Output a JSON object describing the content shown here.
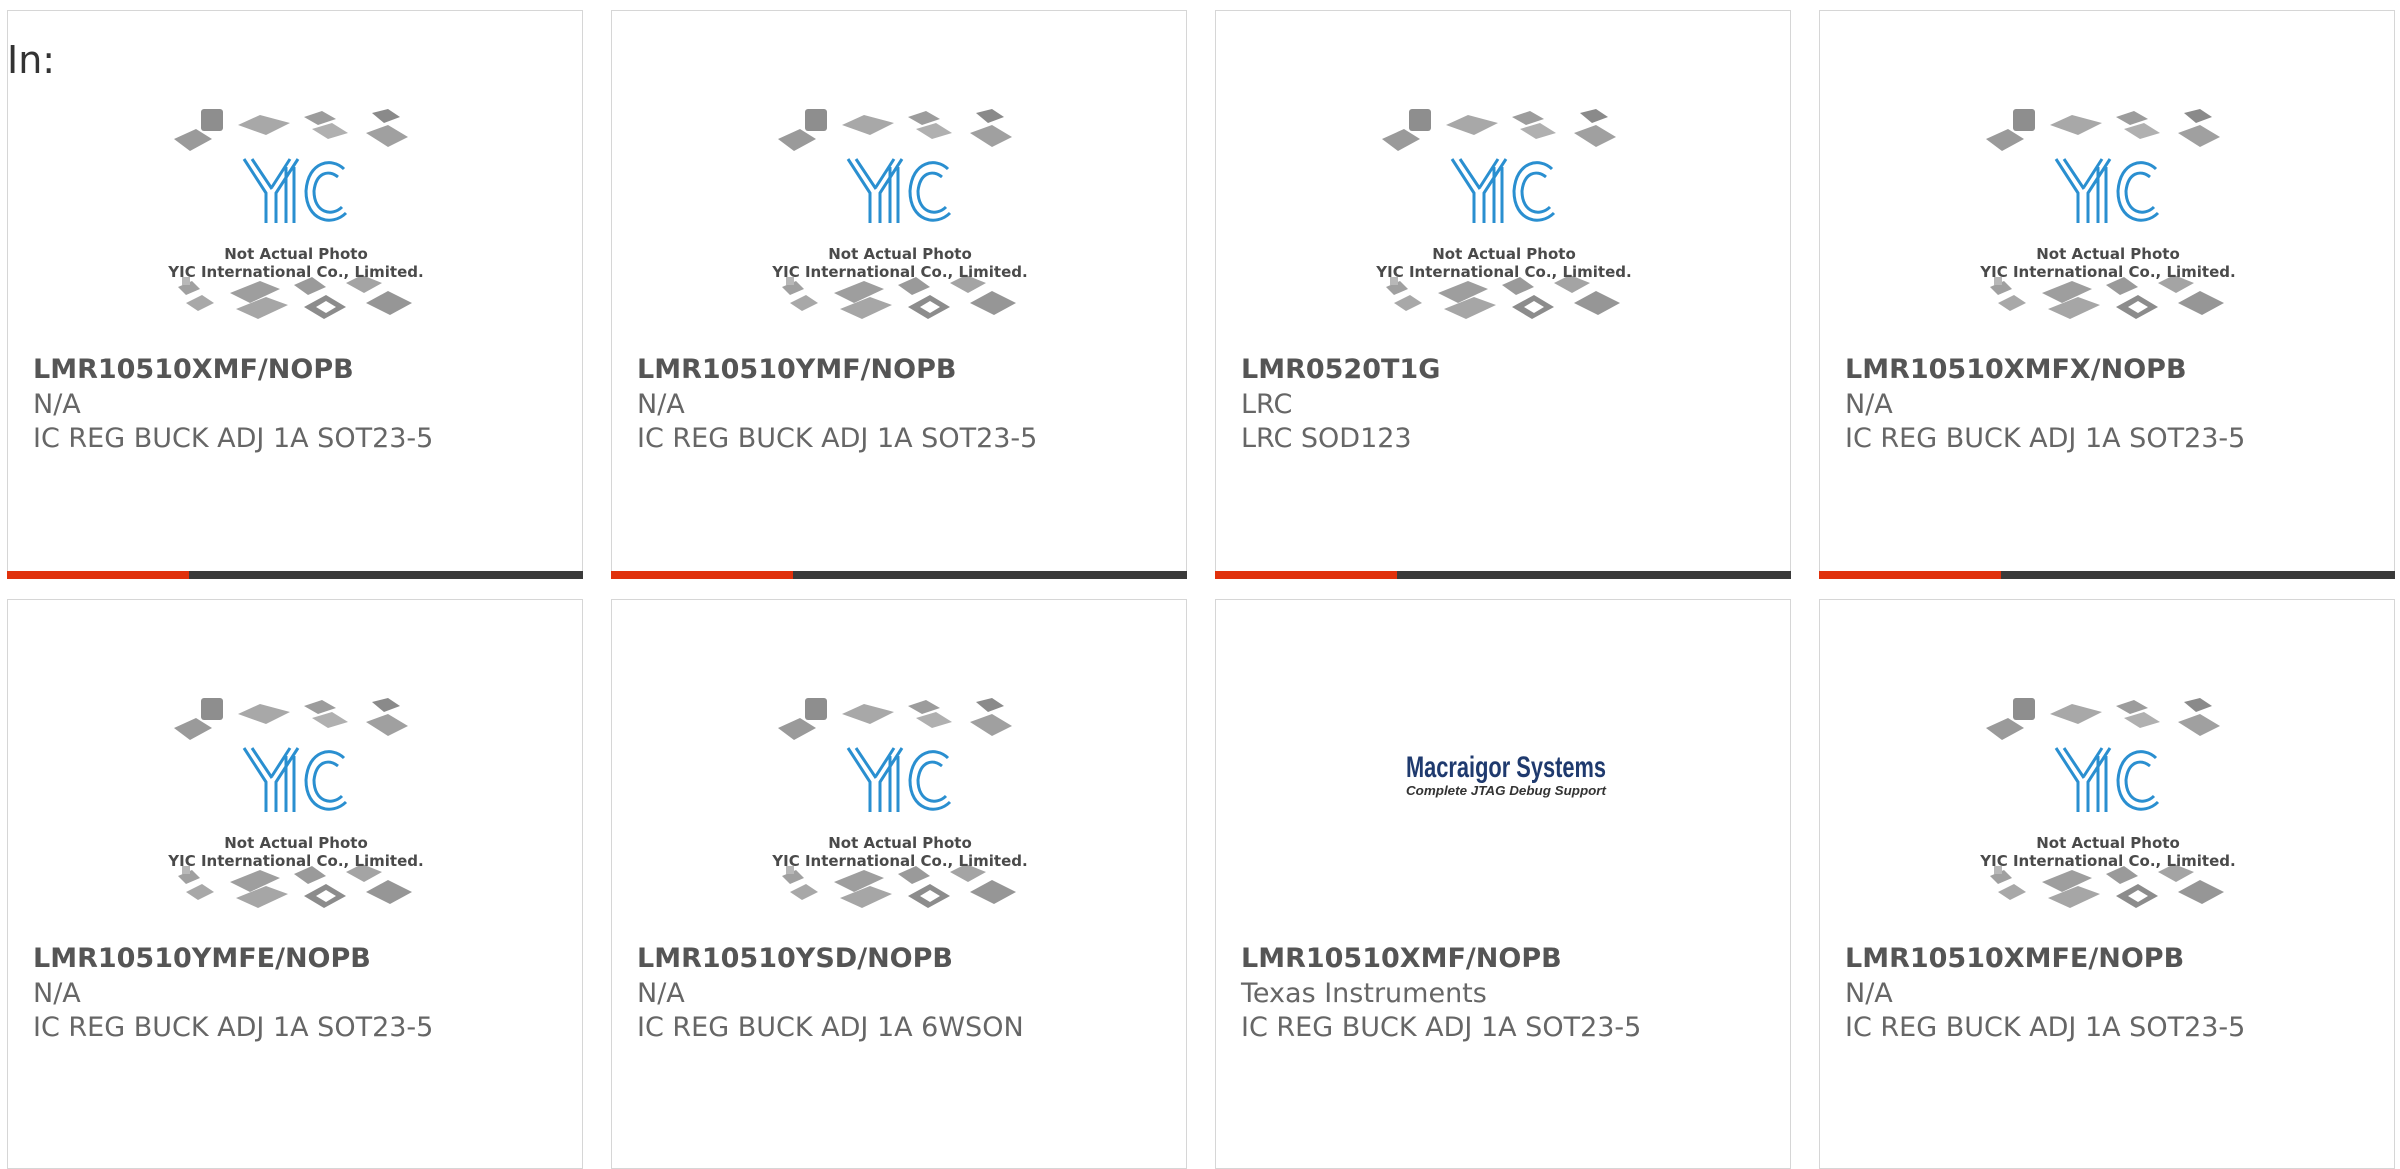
{
  "page": {
    "in_label": "In:"
  },
  "placeholder": {
    "caption_line1": "Not Actual Photo",
    "caption_line2": "YIC International Co., Limited.",
    "logo_text": "YIC"
  },
  "macraigor": {
    "logo_line1": "Macraigor Systems",
    "logo_line2": "Complete JTAG Debug Support"
  },
  "colors": {
    "accent": "#e0310c",
    "bar": "#3a3a3a",
    "yic_blue": "#2a8fd0"
  },
  "cards": [
    {
      "part": "LMR10510XMF/NOPB",
      "manufacturer": "N/A",
      "description": "IC REG BUCK ADJ 1A SOT23-5",
      "image": "yic-placeholder"
    },
    {
      "part": "LMR10510YMF/NOPB",
      "manufacturer": "N/A",
      "description": "IC REG BUCK ADJ 1A SOT23-5",
      "image": "yic-placeholder"
    },
    {
      "part": "LMR0520T1G",
      "manufacturer": "LRC",
      "description": "LRC SOD123",
      "image": "yic-placeholder"
    },
    {
      "part": "LMR10510XMFX/NOPB",
      "manufacturer": "N/A",
      "description": "IC REG BUCK ADJ 1A SOT23-5",
      "image": "yic-placeholder"
    },
    {
      "part": "LMR10510YMFE/NOPB",
      "manufacturer": "N/A",
      "description": "IC REG BUCK ADJ 1A SOT23-5",
      "image": "yic-placeholder"
    },
    {
      "part": "LMR10510YSD/NOPB",
      "manufacturer": "N/A",
      "description": "IC REG BUCK ADJ 1A 6WSON",
      "image": "yic-placeholder"
    },
    {
      "part": "LMR10510XMF/NOPB",
      "manufacturer": "Texas Instruments",
      "description": "IC REG BUCK ADJ 1A SOT23-5",
      "image": "macraigor-logo"
    },
    {
      "part": "LMR10510XMFE/NOPB",
      "manufacturer": "N/A",
      "description": "IC REG BUCK ADJ 1A SOT23-5",
      "image": "yic-placeholder"
    }
  ]
}
